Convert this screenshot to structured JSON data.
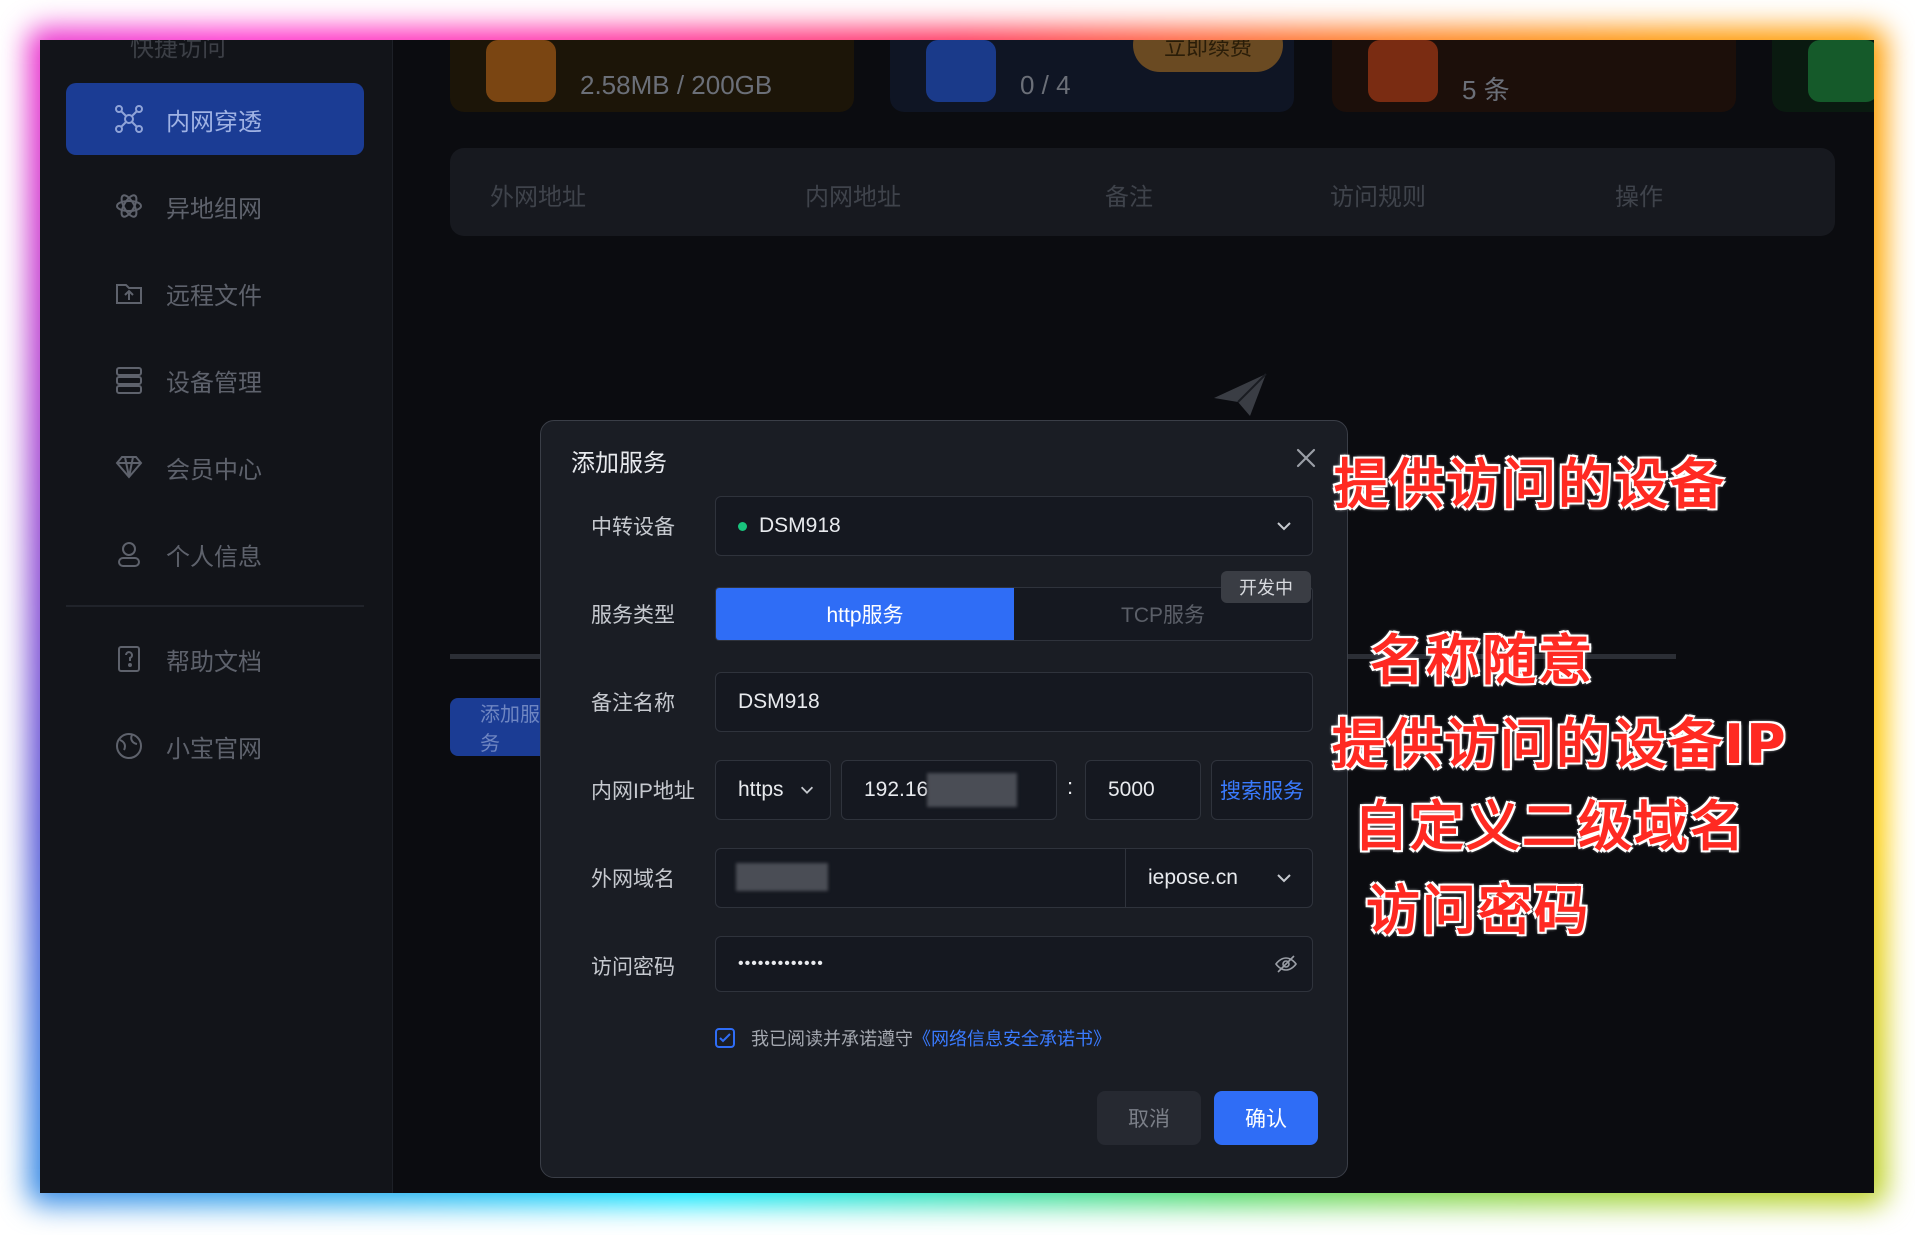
{
  "sidebar": {
    "top_cut": "快捷访问",
    "items": [
      {
        "label": "内网穿透",
        "icon": "network-nodes-icon",
        "active": true
      },
      {
        "label": "异地组网",
        "icon": "atom-icon",
        "active": false
      },
      {
        "label": "远程文件",
        "icon": "folder-upload-icon",
        "active": false
      },
      {
        "label": "设备管理",
        "icon": "server-icon",
        "active": false
      },
      {
        "label": "会员中心",
        "icon": "diamond-icon",
        "active": false
      },
      {
        "label": "个人信息",
        "icon": "user-icon",
        "active": false
      },
      {
        "label": "帮助文档",
        "icon": "help-doc-icon",
        "active": false
      },
      {
        "label": "小宝官网",
        "icon": "globe-icon",
        "active": false
      }
    ]
  },
  "stats": {
    "traffic": "2.58MB / 200GB",
    "devices": "0 / 4",
    "renew_label": "立即续费",
    "rules": "5 条"
  },
  "table": {
    "headers": [
      "外网地址",
      "内网地址",
      "备注",
      "访问规则",
      "操作"
    ],
    "add_button": "添加服务"
  },
  "modal": {
    "title": "添加服务",
    "relay_device": {
      "label": "中转设备",
      "value": "DSM918",
      "status_color": "#19c37d"
    },
    "service_type": {
      "label": "服务类型",
      "options": [
        "http服务",
        "TCP服务"
      ],
      "selected": "http服务",
      "badge": "开发中"
    },
    "remark": {
      "label": "备注名称",
      "value": "DSM918"
    },
    "lan_ip": {
      "label": "内网IP地址",
      "protocol": "https",
      "ip": "192.16",
      "separator": ":",
      "port": "5000",
      "search_button": "搜索服务"
    },
    "domain": {
      "label": "外网域名",
      "suffix": "iepose.cn"
    },
    "password": {
      "label": "访问密码",
      "value": "•••••••••••••"
    },
    "agreement": {
      "text": "我已阅读并承诺遵守",
      "link": "《网络信息安全承诺书》",
      "checked": true
    },
    "cancel": "取消",
    "confirm": "确认"
  },
  "annotations": [
    "提供访问的设备",
    "名称随意",
    "提供访问的设备IP",
    "自定义二级域名",
    "访问密码"
  ],
  "colors": {
    "accent": "#2f6df6",
    "annotation": "#ff2a22",
    "background": "#0b0c10"
  }
}
